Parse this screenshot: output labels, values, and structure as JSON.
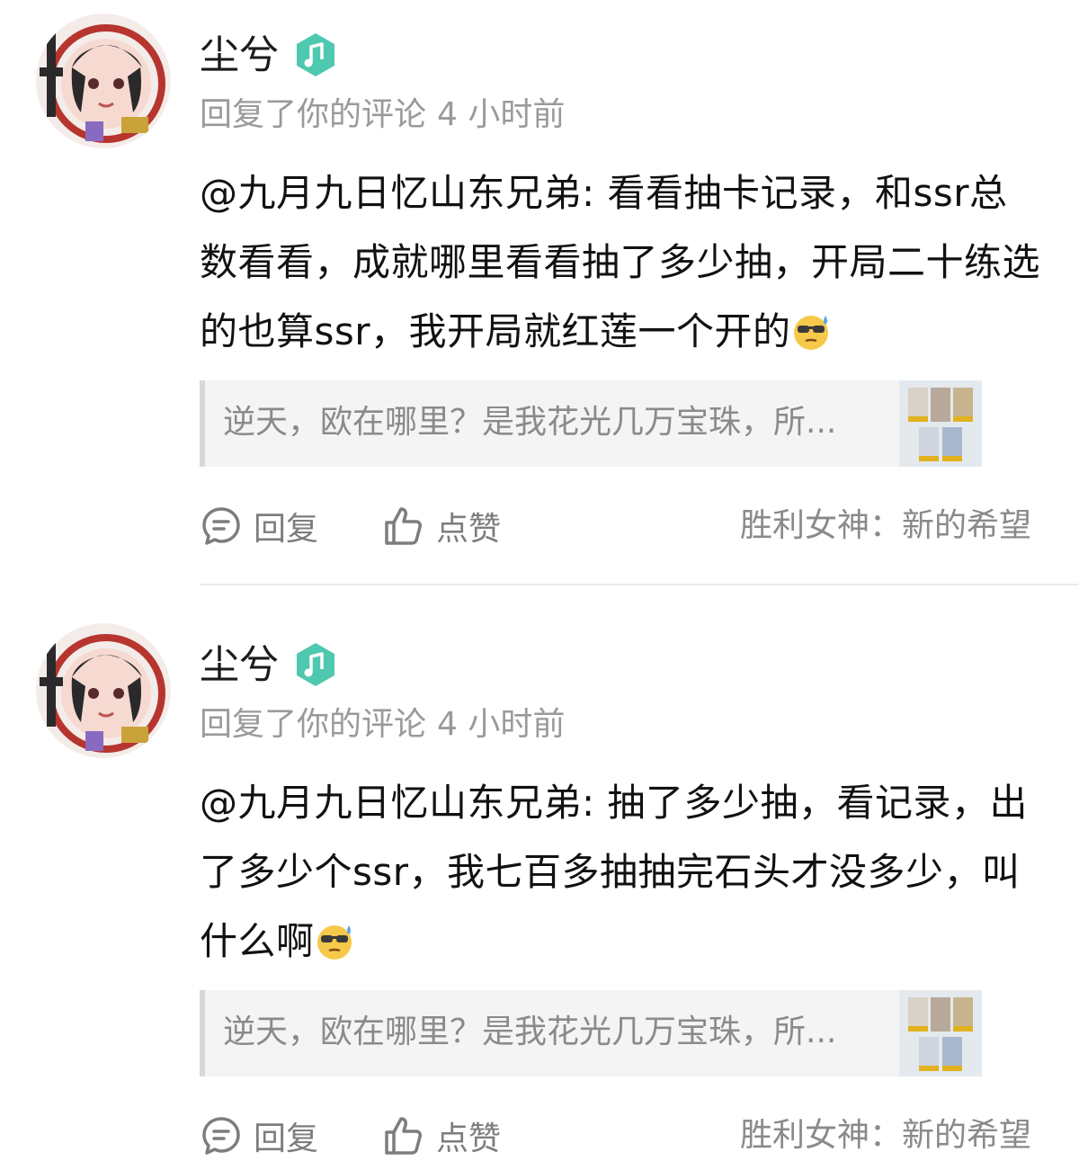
{
  "comments": [
    {
      "username": "尘兮",
      "badge_icon": "music-note-icon",
      "action": "回复了你的评论",
      "time": "4 小时前",
      "body": "@九月九日忆山东兄弟: 看看抽卡记录，和ssr总数看看，成就哪里看看抽了多少抽，开局二十练选的也算ssr，我开局就红莲一个开的",
      "quote_text": "逆天，欧在哪里？是我花光几万宝珠，所...",
      "reply_label": "回复",
      "like_label": "点赞",
      "game_label": "胜利女神：新的希望"
    },
    {
      "username": "尘兮",
      "badge_icon": "music-note-icon",
      "action": "回复了你的评论",
      "time": "4 小时前",
      "body": "@九月九日忆山东兄弟: 抽了多少抽，看记录，出了多少个ssr，我七百多抽抽完石头才没多少，叫什么啊",
      "quote_text": "逆天，欧在哪里？是我花光几万宝珠，所...",
      "reply_label": "回复",
      "like_label": "点赞",
      "game_label": "胜利女神：新的希望"
    }
  ],
  "colors": {
    "badge": "#4fc8b0",
    "muted": "#9a9a9a",
    "quote_bg": "#f4f4f4"
  }
}
